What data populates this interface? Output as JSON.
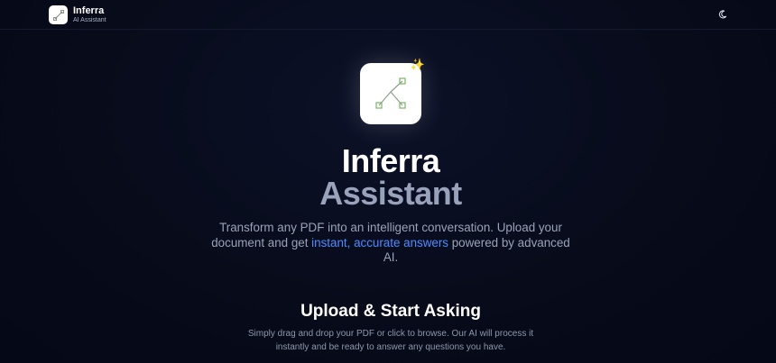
{
  "header": {
    "brand_name": "Inferra",
    "brand_subtitle": "AI Assistant",
    "logo_icon": "graph-node-icon",
    "theme_toggle_icon": "moon-icon"
  },
  "hero": {
    "icon": "graph-node-icon",
    "sparkle_icon": "sparkle-icon",
    "title_line1": "Inferra",
    "title_line2": "Assistant",
    "description_part1": "Transform any PDF into an intelligent conversation. Upload your document and get ",
    "description_accent": "instant, accurate answers",
    "description_part2": " powered by advanced AI."
  },
  "upload": {
    "title": "Upload & Start Asking",
    "description": "Simply drag and drop your PDF or click to browse. Our AI will process it instantly and be ready to answer any questions you have."
  },
  "colors": {
    "background": "#060a18",
    "accent": "#4f8bff",
    "muted_title": "#98a2ba",
    "icon_green": "#7fb36a",
    "sparkle": "#f5c84b"
  }
}
